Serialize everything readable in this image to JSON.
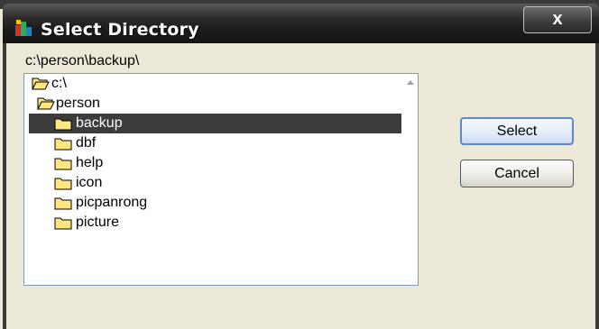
{
  "window": {
    "title": "Select Directory",
    "close_label": "x"
  },
  "path_label": "c:\\person\\backup\\",
  "tree": {
    "nodes": [
      {
        "label": "c:\\",
        "state": "open"
      },
      {
        "label": "person",
        "state": "open"
      },
      {
        "label": "backup",
        "state": "closed",
        "selected": true
      },
      {
        "label": "dbf",
        "state": "closed"
      },
      {
        "label": "help",
        "state": "closed"
      },
      {
        "label": "icon",
        "state": "closed"
      },
      {
        "label": "picpanrong",
        "state": "closed"
      },
      {
        "label": "picture",
        "state": "closed"
      }
    ]
  },
  "buttons": {
    "select_label": "Select",
    "cancel_label": "Cancel"
  },
  "colors": {
    "selection": "#3c3c3c",
    "folder_fill": "#ffe680",
    "titlebar": "#1a1a1a"
  }
}
